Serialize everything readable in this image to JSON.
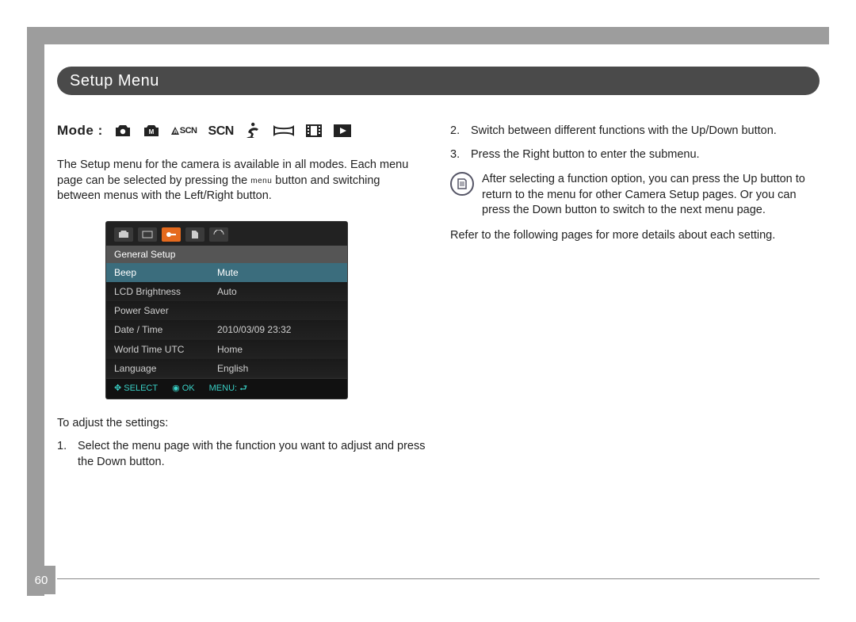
{
  "page_number": "60",
  "section_title": "Setup Menu",
  "mode_label": "Mode :",
  "mode_icons": {
    "auto_scene": "ASCN",
    "scene": "SCN"
  },
  "left": {
    "intro_a": "The Setup menu for the camera is available in all modes. Each menu page can be selected by pressing the ",
    "intro_menu_word": "menu",
    "intro_b": " button and switching between menus with the Left/Right button.",
    "to_adjust_label": "To adjust the settings:",
    "step1_num": "1.",
    "step1_text": "Select the menu page with the function you want to adjust and press the Down button."
  },
  "right": {
    "step2_num": "2.",
    "step2_text": "Switch between different functions with the Up/Down button.",
    "step3_num": "3.",
    "step3_text": "Press the Right button to enter the submenu.",
    "note_text": "After selecting a function option, you can press the Up button to return to the menu for other Camera Setup pages. Or you can press the Down button to switch to the next menu page.",
    "refer_text": "Refer to the following pages for more details about each setting."
  },
  "lcd": {
    "section": "General Setup",
    "rows": [
      {
        "label": "Beep",
        "value": "Mute"
      },
      {
        "label": "LCD Brightness",
        "value": "Auto"
      },
      {
        "label": "Power Saver",
        "value": ""
      },
      {
        "label": "Date / Time",
        "value": "2010/03/09 23:32"
      },
      {
        "label": "World Time UTC",
        "value": "Home"
      },
      {
        "label": "Language",
        "value": "English"
      }
    ],
    "footer": {
      "select": "SELECT",
      "ok": "OK",
      "menu": "MENU:"
    }
  }
}
